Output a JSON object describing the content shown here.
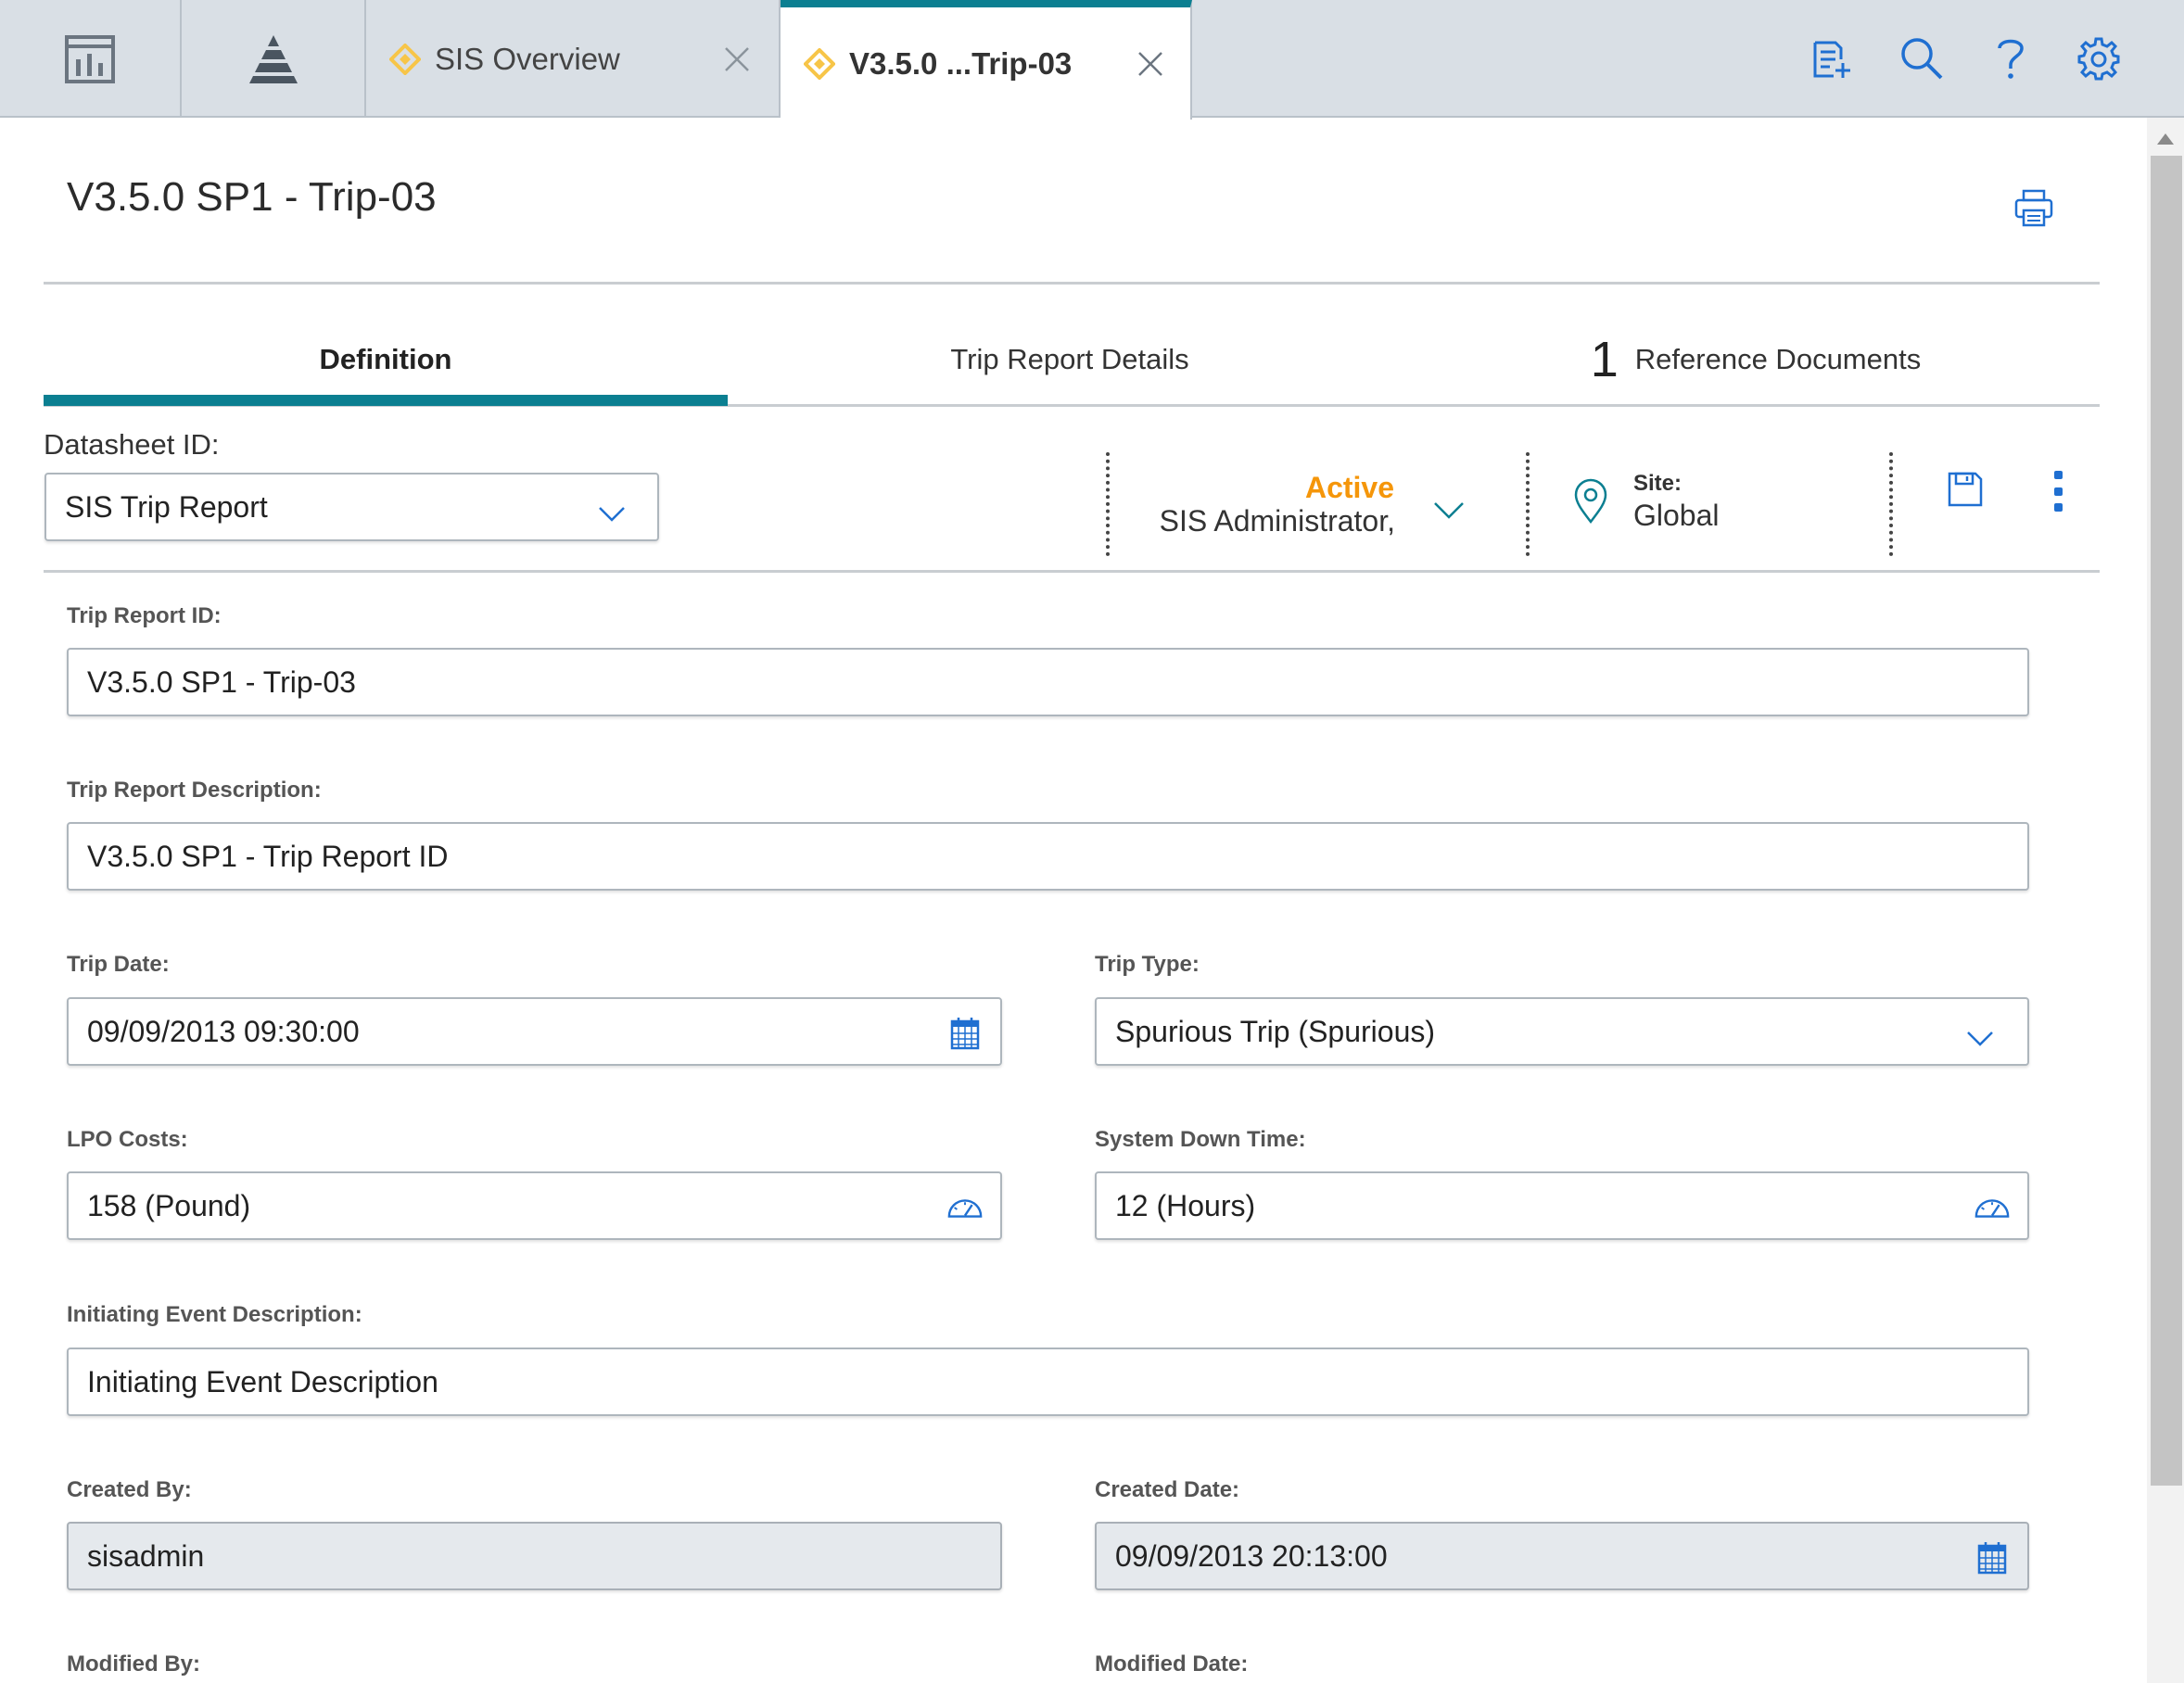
{
  "colors": {
    "accent_teal": "#0b7f91",
    "icon_blue": "#1f6fd1",
    "state_orange": "#f5960a",
    "tab_diamond": "#f7c548",
    "topbar_bg": "#d9dfe5",
    "readonly_bg": "#e5e9ed"
  },
  "topbar": {
    "nav_icons": [
      "dashboard-icon",
      "pyramid-icon"
    ],
    "tabs": [
      {
        "label": "SIS Overview",
        "icon": "diamond-icon",
        "active": false
      },
      {
        "label": "V3.5.0 ...Trip-03",
        "icon": "diamond-icon",
        "active": true
      }
    ],
    "right_icons": [
      "new-record-icon",
      "search-icon",
      "help-icon",
      "settings-icon"
    ]
  },
  "header": {
    "title": "V3.5.0 SP1 - Trip-03",
    "print_icon": "print-icon"
  },
  "inner_tabs": {
    "definition": "Definition",
    "trip_report_details": "Trip Report Details",
    "reference_count": "1",
    "reference_documents": "Reference Documents"
  },
  "datasheet": {
    "label": "Datasheet ID:",
    "value": "SIS Trip Report"
  },
  "state": {
    "status": "Active",
    "user": "SIS Administrator,"
  },
  "site": {
    "label": "Site:",
    "value": "Global"
  },
  "form": {
    "trip_report_id": {
      "label": "Trip Report ID:",
      "value": "V3.5.0 SP1 - Trip-03"
    },
    "trip_report_description": {
      "label": "Trip Report Description:",
      "value": "V3.5.0 SP1 - Trip Report ID"
    },
    "trip_date": {
      "label": "Trip Date:",
      "value": "09/09/2013 09:30:00"
    },
    "trip_type": {
      "label": "Trip Type:",
      "value": "Spurious Trip (Spurious)"
    },
    "lpo_costs": {
      "label": "LPO Costs:",
      "value": "158 (Pound)"
    },
    "system_down_time": {
      "label": "System Down Time:",
      "value": "12 (Hours)"
    },
    "initiating_event_description": {
      "label": "Initiating Event Description:",
      "value": "Initiating Event Description"
    },
    "created_by": {
      "label": "Created By:",
      "value": "sisadmin"
    },
    "created_date": {
      "label": "Created Date:",
      "value": "09/09/2013 20:13:00"
    },
    "modified_by": {
      "label": "Modified By:"
    },
    "modified_date": {
      "label": "Modified Date:"
    }
  }
}
